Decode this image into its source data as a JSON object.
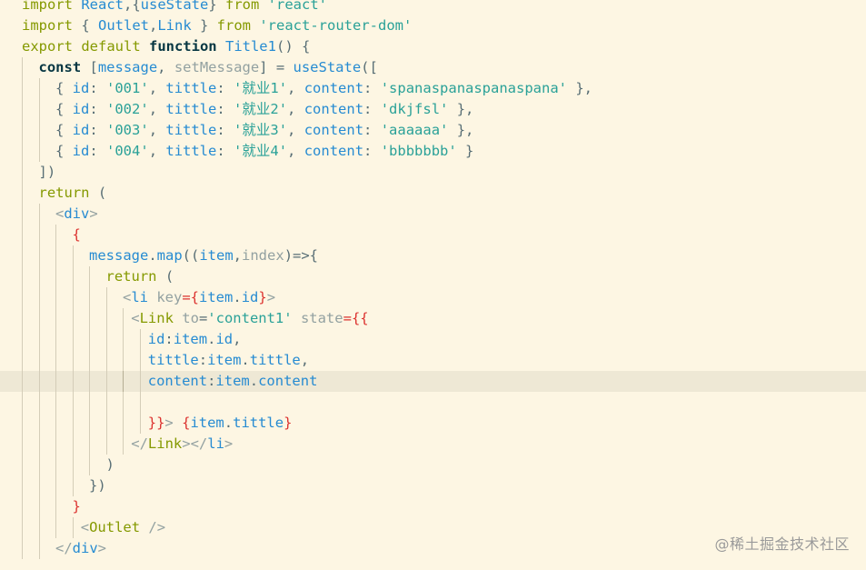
{
  "editor": {
    "lines": [
      {
        "indent": 0,
        "tokens": [
          {
            "t": "import ",
            "c": "kw"
          },
          {
            "t": "React",
            "c": "vr"
          },
          {
            "t": ",{",
            "c": "pl"
          },
          {
            "t": "useState",
            "c": "vr"
          },
          {
            "t": "} ",
            "c": "pl"
          },
          {
            "t": "from ",
            "c": "kw"
          },
          {
            "t": "'react'",
            "c": "st"
          }
        ]
      },
      {
        "indent": 0,
        "tokens": [
          {
            "t": "import ",
            "c": "kw"
          },
          {
            "t": "{ ",
            "c": "pl"
          },
          {
            "t": "Outlet",
            "c": "vr"
          },
          {
            "t": ",",
            "c": "pl"
          },
          {
            "t": "Link",
            "c": "vr"
          },
          {
            "t": " } ",
            "c": "pl"
          },
          {
            "t": "from ",
            "c": "kw"
          },
          {
            "t": "'react-router-dom'",
            "c": "st"
          }
        ]
      },
      {
        "indent": 0,
        "tokens": [
          {
            "t": "export ",
            "c": "kw"
          },
          {
            "t": "default ",
            "c": "kw"
          },
          {
            "t": "function ",
            "c": "kwb"
          },
          {
            "t": "Title1",
            "c": "fn"
          },
          {
            "t": "() {",
            "c": "pl"
          }
        ]
      },
      {
        "indent": 1,
        "tokens": [
          {
            "t": "const ",
            "c": "kwb"
          },
          {
            "t": "[",
            "c": "pl"
          },
          {
            "t": "message",
            "c": "vr"
          },
          {
            "t": ", ",
            "c": "pl"
          },
          {
            "t": "setMessage",
            "c": "dim"
          },
          {
            "t": "] = ",
            "c": "pl"
          },
          {
            "t": "useState",
            "c": "fn"
          },
          {
            "t": "([",
            "c": "pl"
          }
        ]
      },
      {
        "indent": 2,
        "tokens": [
          {
            "t": "{ ",
            "c": "pl"
          },
          {
            "t": "id",
            "c": "vr"
          },
          {
            "t": ": ",
            "c": "pl"
          },
          {
            "t": "'001'",
            "c": "st"
          },
          {
            "t": ", ",
            "c": "pl"
          },
          {
            "t": "tittle",
            "c": "vr"
          },
          {
            "t": ": ",
            "c": "pl"
          },
          {
            "t": "'就业1'",
            "c": "st"
          },
          {
            "t": ", ",
            "c": "pl"
          },
          {
            "t": "content",
            "c": "vr"
          },
          {
            "t": ": ",
            "c": "pl"
          },
          {
            "t": "'spanaspanaspanaspana'",
            "c": "st"
          },
          {
            "t": " },",
            "c": "pl"
          }
        ]
      },
      {
        "indent": 2,
        "tokens": [
          {
            "t": "{ ",
            "c": "pl"
          },
          {
            "t": "id",
            "c": "vr"
          },
          {
            "t": ": ",
            "c": "pl"
          },
          {
            "t": "'002'",
            "c": "st"
          },
          {
            "t": ", ",
            "c": "pl"
          },
          {
            "t": "tittle",
            "c": "vr"
          },
          {
            "t": ": ",
            "c": "pl"
          },
          {
            "t": "'就业2'",
            "c": "st"
          },
          {
            "t": ", ",
            "c": "pl"
          },
          {
            "t": "content",
            "c": "vr"
          },
          {
            "t": ": ",
            "c": "pl"
          },
          {
            "t": "'dkjfsl'",
            "c": "st"
          },
          {
            "t": " },",
            "c": "pl"
          }
        ]
      },
      {
        "indent": 2,
        "tokens": [
          {
            "t": "{ ",
            "c": "pl"
          },
          {
            "t": "id",
            "c": "vr"
          },
          {
            "t": ": ",
            "c": "pl"
          },
          {
            "t": "'003'",
            "c": "st"
          },
          {
            "t": ", ",
            "c": "pl"
          },
          {
            "t": "tittle",
            "c": "vr"
          },
          {
            "t": ": ",
            "c": "pl"
          },
          {
            "t": "'就业3'",
            "c": "st"
          },
          {
            "t": ", ",
            "c": "pl"
          },
          {
            "t": "content",
            "c": "vr"
          },
          {
            "t": ": ",
            "c": "pl"
          },
          {
            "t": "'aaaaaa'",
            "c": "st"
          },
          {
            "t": " },",
            "c": "pl"
          }
        ]
      },
      {
        "indent": 2,
        "tokens": [
          {
            "t": "{ ",
            "c": "pl"
          },
          {
            "t": "id",
            "c": "vr"
          },
          {
            "t": ": ",
            "c": "pl"
          },
          {
            "t": "'004'",
            "c": "st"
          },
          {
            "t": ", ",
            "c": "pl"
          },
          {
            "t": "tittle",
            "c": "vr"
          },
          {
            "t": ": ",
            "c": "pl"
          },
          {
            "t": "'就业4'",
            "c": "st"
          },
          {
            "t": ", ",
            "c": "pl"
          },
          {
            "t": "content",
            "c": "vr"
          },
          {
            "t": ": ",
            "c": "pl"
          },
          {
            "t": "'bbbbbbb'",
            "c": "st"
          },
          {
            "t": " }",
            "c": "pl"
          }
        ]
      },
      {
        "indent": 1,
        "tokens": [
          {
            "t": "])",
            "c": "pl"
          }
        ]
      },
      {
        "indent": 1,
        "tokens": [
          {
            "t": "return ",
            "c": "kw"
          },
          {
            "t": "(",
            "c": "pl"
          }
        ]
      },
      {
        "indent": 2,
        "tokens": [
          {
            "t": "<",
            "c": "dim"
          },
          {
            "t": "div",
            "c": "tag"
          },
          {
            "t": ">",
            "c": "dim"
          }
        ]
      },
      {
        "indent": 3,
        "tokens": [
          {
            "t": "{",
            "c": "br"
          }
        ]
      },
      {
        "indent": 4,
        "tokens": [
          {
            "t": "message",
            "c": "vr"
          },
          {
            "t": ".",
            "c": "pl"
          },
          {
            "t": "map",
            "c": "fn"
          },
          {
            "t": "((",
            "c": "pl"
          },
          {
            "t": "item",
            "c": "vr"
          },
          {
            "t": ",",
            "c": "pl"
          },
          {
            "t": "index",
            "c": "dim"
          },
          {
            "t": ")=>{",
            "c": "pl"
          }
        ]
      },
      {
        "indent": 5,
        "tokens": [
          {
            "t": "return ",
            "c": "kw"
          },
          {
            "t": "(",
            "c": "pl"
          }
        ]
      },
      {
        "indent": 6,
        "tokens": [
          {
            "t": "<",
            "c": "dim"
          },
          {
            "t": "li ",
            "c": "tag"
          },
          {
            "t": "key",
            "c": "attr"
          },
          {
            "t": "={",
            "c": "br"
          },
          {
            "t": "item",
            "c": "vr"
          },
          {
            "t": ".",
            "c": "pl"
          },
          {
            "t": "id",
            "c": "vr"
          },
          {
            "t": "}",
            "c": "br"
          },
          {
            "t": ">",
            "c": "dim"
          }
        ]
      },
      {
        "indent": 6.5,
        "tokens": [
          {
            "t": "<",
            "c": "dim"
          },
          {
            "t": "Link ",
            "c": "kw"
          },
          {
            "t": "to",
            "c": "attr"
          },
          {
            "t": "=",
            "c": "pl"
          },
          {
            "t": "'content1' ",
            "c": "st"
          },
          {
            "t": "state",
            "c": "attr"
          },
          {
            "t": "={{",
            "c": "br"
          }
        ]
      },
      {
        "indent": 7.5,
        "tokens": [
          {
            "t": "id",
            "c": "vr"
          },
          {
            "t": ":",
            "c": "pl"
          },
          {
            "t": "item",
            "c": "vr"
          },
          {
            "t": ".",
            "c": "pl"
          },
          {
            "t": "id",
            "c": "vr"
          },
          {
            "t": ",",
            "c": "pl"
          }
        ]
      },
      {
        "indent": 7.5,
        "tokens": [
          {
            "t": "tittle",
            "c": "vr"
          },
          {
            "t": ":",
            "c": "pl"
          },
          {
            "t": "item",
            "c": "vr"
          },
          {
            "t": ".",
            "c": "pl"
          },
          {
            "t": "tittle",
            "c": "vr"
          },
          {
            "t": ",",
            "c": "pl"
          }
        ]
      },
      {
        "indent": 7.5,
        "current": true,
        "tokens": [
          {
            "t": "content",
            "c": "vr"
          },
          {
            "t": ":",
            "c": "pl"
          },
          {
            "t": "item",
            "c": "vr"
          },
          {
            "t": ".",
            "c": "pl"
          },
          {
            "t": "content",
            "c": "vr"
          }
        ]
      },
      {
        "indent": 7.5,
        "tokens": []
      },
      {
        "indent": 7.5,
        "tokens": [
          {
            "t": "}}",
            "c": "br"
          },
          {
            "t": "> ",
            "c": "dim"
          },
          {
            "t": "{",
            "c": "br"
          },
          {
            "t": "item",
            "c": "vr"
          },
          {
            "t": ".",
            "c": "pl"
          },
          {
            "t": "tittle",
            "c": "vr"
          },
          {
            "t": "}",
            "c": "br"
          }
        ]
      },
      {
        "indent": 6.5,
        "tokens": [
          {
            "t": "</",
            "c": "dim"
          },
          {
            "t": "Link",
            "c": "kw"
          },
          {
            "t": "></",
            "c": "dim"
          },
          {
            "t": "li",
            "c": "tag"
          },
          {
            "t": ">",
            "c": "dim"
          }
        ]
      },
      {
        "indent": 5,
        "tokens": [
          {
            "t": ")",
            "c": "pl"
          }
        ]
      },
      {
        "indent": 4,
        "tokens": [
          {
            "t": "})",
            "c": "pl"
          }
        ]
      },
      {
        "indent": 3,
        "tokens": [
          {
            "t": "}",
            "c": "br"
          }
        ]
      },
      {
        "indent": 3.5,
        "tokens": [
          {
            "t": "<",
            "c": "dim"
          },
          {
            "t": "Outlet ",
            "c": "kw"
          },
          {
            "t": "/>",
            "c": "dim"
          }
        ]
      },
      {
        "indent": 2,
        "tokens": [
          {
            "t": "</",
            "c": "dim"
          },
          {
            "t": "div",
            "c": "tag"
          },
          {
            "t": ">",
            "c": "dim"
          }
        ]
      }
    ]
  },
  "watermark": "@稀土掘金技术社区",
  "colors": {
    "background": "#fdf6e3",
    "current_line": "#eee8d5",
    "keyword": "#859900",
    "string": "#2aa198",
    "variable": "#268bd2",
    "bracket": "#dc322f"
  }
}
